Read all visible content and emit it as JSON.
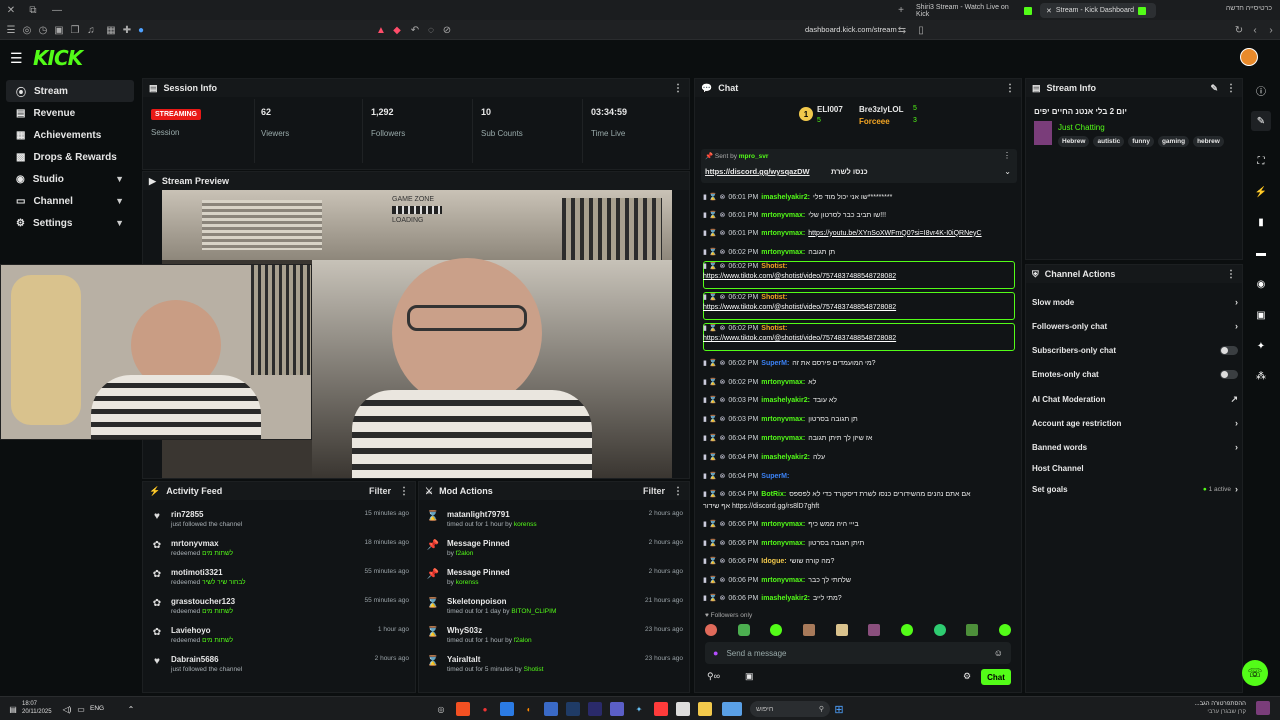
{
  "browser": {
    "tabs": [
      {
        "label": "Shiri3 Stream - Watch Live on Kick"
      },
      {
        "label": "Stream - Kick Dashboard"
      }
    ],
    "url": "dashboard.kick.com/stream",
    "rtl_label": "כרטיסייה חדשה"
  },
  "app": {
    "logo": "KICK"
  },
  "sidebar": {
    "items": [
      {
        "label": "Stream",
        "icon": "stream-icon"
      },
      {
        "label": "Revenue",
        "icon": "revenue-icon"
      },
      {
        "label": "Achievements",
        "icon": "trophy-icon"
      },
      {
        "label": "Drops & Rewards",
        "icon": "gift-icon"
      },
      {
        "label": "Studio",
        "icon": "studio-icon",
        "chevron": true
      },
      {
        "label": "Channel",
        "icon": "channel-icon",
        "chevron": true
      },
      {
        "label": "Settings",
        "icon": "gear-icon",
        "chevron": true
      }
    ]
  },
  "session": {
    "title": "Session Info",
    "status": "STREAMING",
    "status_label": "Session",
    "stats": [
      {
        "value": "62",
        "label": "Viewers"
      },
      {
        "value": "1,292",
        "label": "Followers"
      },
      {
        "value": "10",
        "label": "Sub Counts"
      },
      {
        "value": "03:34:59",
        "label": "Time Live"
      }
    ]
  },
  "preview": {
    "title": "Stream Preview",
    "sign": "GAME ZONE",
    "loading": "LOADING"
  },
  "activity": {
    "title": "Activity Feed",
    "filter": "Filter",
    "items": [
      {
        "name": "rin72855",
        "sub": "just followed the channel",
        "reward": "",
        "time": "15 minutes ago"
      },
      {
        "name": "mrtonyvmax",
        "sub": "redeemed",
        "reward": "לשתות מים",
        "time": "18 minutes ago"
      },
      {
        "name": "motimoti3321",
        "sub": "redeemed",
        "reward": "לבחור שיר לשיר",
        "time": "55 minutes ago"
      },
      {
        "name": "grasstoucher123",
        "sub": "redeemed",
        "reward": "לשתות מים",
        "time": "55 minutes ago"
      },
      {
        "name": "Laviehoyo",
        "sub": "redeemed",
        "reward": "לשתות מים",
        "time": "1 hour ago"
      },
      {
        "name": "Dabrain5686",
        "sub": "just followed the channel",
        "reward": "",
        "time": "2 hours ago"
      }
    ]
  },
  "mod": {
    "title": "Mod Actions",
    "filter": "Filter",
    "items": [
      {
        "name": "matanlight79791",
        "sub": "timed out for 1 hour by",
        "by": "korenss",
        "time": "2 hours ago"
      },
      {
        "name": "Message Pinned",
        "sub": "by",
        "by": "f2alon",
        "time": "2 hours ago"
      },
      {
        "name": "Message Pinned",
        "sub": "by",
        "by": "korenss",
        "time": "2 hours ago"
      },
      {
        "name": "Skeletonpoison",
        "sub": "timed out for 1 day by",
        "by": "BITON_CLIPIM",
        "time": "21 hours ago"
      },
      {
        "name": "WhyS03z",
        "sub": "timed out for 1 hour by",
        "by": "f2alon",
        "time": "23 hours ago"
      },
      {
        "name": "Yairaltalt",
        "sub": "timed out for 5 minutes by",
        "by": "Shotist",
        "time": "23 hours ago"
      }
    ]
  },
  "chat": {
    "title": "Chat",
    "top": [
      {
        "name": "ELI007",
        "count": "5"
      },
      {
        "name": "Bre3zlyLOL",
        "count": "5"
      },
      {
        "name": "Forceee",
        "count": "3"
      }
    ],
    "pinned_by": "Sent by",
    "pinned_user": "mpro_svr",
    "pinned_text": "כנסו לשרת",
    "pinned_link": "https://discord.gg/wysqazDW",
    "messages": [
      {
        "time": "06:01 PM",
        "user": "imashelyakir2:",
        "cls": "",
        "text": "שו אני יכול מוד פלי*********"
      },
      {
        "time": "06:01 PM",
        "user": "mrtonyvmax:",
        "cls": "",
        "text": "שו תביב כבר לסרטון שלי!!!"
      },
      {
        "time": "06:01 PM",
        "user": "mrtonyvmax:",
        "cls": "",
        "text": "https://youtu.be/XYnSoXWFmQ0?si=I8vr4K-I0iQRNeyC"
      },
      {
        "time": "06:02 PM",
        "user": "mrtonyvmax:",
        "cls": "",
        "text": "תן תגובה"
      },
      {
        "time": "06:02 PM",
        "user": "Shotist:",
        "cls": "o",
        "text": "https://www.tiktok.com/@shotist/video/7574837488548728082"
      },
      {
        "time": "06:02 PM",
        "user": "Shotist:",
        "cls": "o",
        "text": "https://www.tiktok.com/@shotist/video/7574837488548728082"
      },
      {
        "time": "06:02 PM",
        "user": "Shotist:",
        "cls": "o",
        "text": "https://www.tiktok.com/@shotist/video/7574837488548728082"
      },
      {
        "time": "06:02 PM",
        "user": "SuperM:",
        "cls": "b",
        "text": "מי המועמדים פירסם את זה?"
      },
      {
        "time": "06:02 PM",
        "user": "mrtonyvmax:",
        "cls": "",
        "text": "לא"
      },
      {
        "time": "06:03 PM",
        "user": "imashelyakir2:",
        "cls": "",
        "text": "לא עובד"
      },
      {
        "time": "06:03 PM",
        "user": "mrtonyvmax:",
        "cls": "",
        "text": "תן תגובה בסרטון"
      },
      {
        "time": "06:04 PM",
        "user": "mrtonyvmax:",
        "cls": "",
        "text": "אז שיזן לך תיתן תגובה"
      },
      {
        "time": "06:04 PM",
        "user": "imashelyakir2:",
        "cls": "",
        "text": "עלה"
      },
      {
        "time": "06:04 PM",
        "user": "SuperM:",
        "cls": "b",
        "text": ""
      },
      {
        "time": "06:04 PM",
        "user": "BotRix:",
        "cls": "",
        "text": "אם אתם נהנים מהשידורים כנסו לשרת דיסקורד כדי לא לפספס"
      },
      {
        "time": "",
        "user": "",
        "cls": "",
        "text": "אף שידור https://discord.gg/rs8lD7ghft"
      },
      {
        "time": "06:06 PM",
        "user": "mrtonyvmax:",
        "cls": "",
        "text": "בייי היה ממש כיף"
      },
      {
        "time": "06:06 PM",
        "user": "mrtonyvmax:",
        "cls": "",
        "text": "תיתן תגובה בסרטון"
      },
      {
        "time": "06:06 PM",
        "user": "Idogue:",
        "cls": "y",
        "text": "מה קורה שושי?"
      },
      {
        "time": "06:06 PM",
        "user": "mrtonyvmax:",
        "cls": "",
        "text": "שלחתי לך כבר"
      },
      {
        "time": "06:06 PM",
        "user": "imashelyakir2:",
        "cls": "",
        "text": "מתי לייב?"
      }
    ],
    "followers_only": "Followers only",
    "input_placeholder": "Send a message",
    "send": "Chat"
  },
  "stream_info": {
    "title": "Stream Info",
    "stream_title": "יום 2 בלי אנטנ החיים יפים",
    "category": "Just Chatting",
    "tags": [
      "Hebrew",
      "autistic",
      "funny",
      "gaming",
      "hebrew"
    ]
  },
  "channel_actions": {
    "title": "Channel Actions",
    "rows": [
      {
        "label": "Slow mode",
        "type": "chevron"
      },
      {
        "label": "Followers-only chat",
        "type": "chevron"
      },
      {
        "label": "Subscribers-only chat",
        "type": "toggle"
      },
      {
        "label": "Emotes-only chat",
        "type": "toggle"
      },
      {
        "label": "AI Chat Moderation",
        "type": "external"
      },
      {
        "label": "Account age restriction",
        "type": "chevron"
      },
      {
        "label": "Banned words",
        "type": "chevron"
      },
      {
        "label": "Host Channel",
        "type": "none"
      },
      {
        "label": "Set goals",
        "type": "chevron",
        "extra": "1 active"
      }
    ]
  },
  "taskbar": {
    "time": "18:07",
    "date": "20/11/2025",
    "lang": "ENG",
    "search": "חיפוש",
    "notif_title": "...ההסתפרטורה הגב",
    "notif_sub": "קרן שבגרן ערבי"
  },
  "colors": {
    "accent": "#53fc18",
    "live": "#e91916"
  }
}
